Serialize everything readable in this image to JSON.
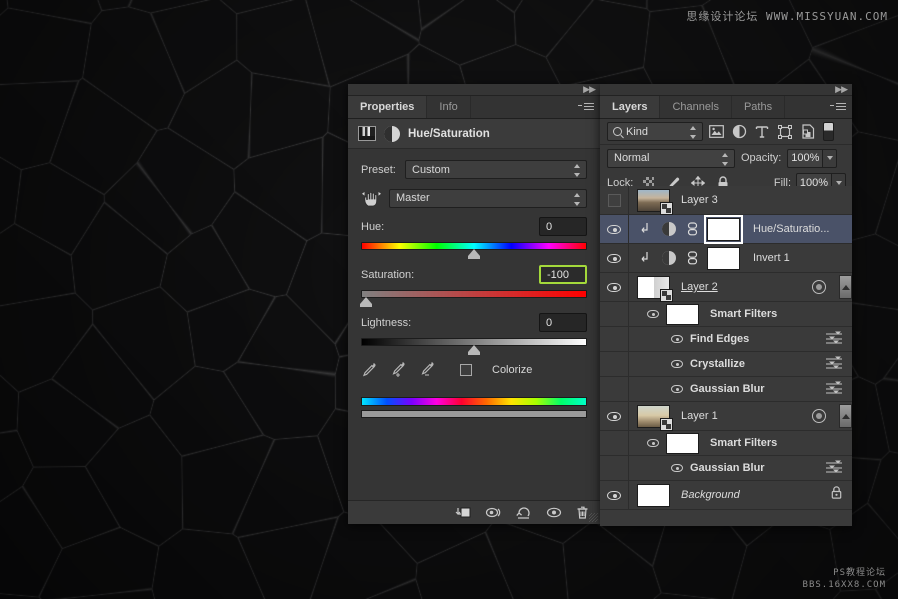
{
  "watermarks": {
    "top": "思缘设计论坛  WWW.MISSYUAN.COM",
    "bottom_line1": "PS教程论坛",
    "bottom_line2": "BBS.16XX8.COM"
  },
  "properties_panel": {
    "tabs": [
      {
        "label": "Properties",
        "active": true
      },
      {
        "label": "Info",
        "active": false
      }
    ],
    "title": "Hue/Saturation",
    "preset_label": "Preset:",
    "preset_value": "Custom",
    "channel_value": "Master",
    "sliders": [
      {
        "label": "Hue:",
        "value": "0",
        "thumb_pct": 50,
        "highlight": false
      },
      {
        "label": "Saturation:",
        "value": "-100",
        "thumb_pct": 2,
        "highlight": true
      },
      {
        "label": "Lightness:",
        "value": "0",
        "thumb_pct": 50,
        "highlight": false
      }
    ],
    "colorize_label": "Colorize",
    "colorize_checked": false,
    "footer_icons": [
      "clip-to-layer-icon",
      "toggle-previous-state-icon",
      "reset-icon",
      "toggle-visibility-icon",
      "delete-icon"
    ]
  },
  "layers_panel": {
    "tabs": [
      {
        "label": "Layers",
        "active": true
      },
      {
        "label": "Channels",
        "active": false
      },
      {
        "label": "Paths",
        "active": false
      }
    ],
    "filter_kind": "Kind",
    "filter_icons": [
      "pixel-filter-icon",
      "adjustment-filter-icon",
      "type-filter-icon",
      "shape-filter-icon",
      "smart-object-filter-icon"
    ],
    "blend_mode": "Normal",
    "opacity_label": "Opacity:",
    "opacity_value": "100%",
    "lock_label": "Lock:",
    "lock_icons": [
      "lock-transparent-pixels-icon",
      "lock-image-pixels-icon",
      "lock-position-icon",
      "lock-all-icon"
    ],
    "fill_label": "Fill:",
    "fill_value": "100%",
    "rows": [
      {
        "type": "layer",
        "name": "Layer 3",
        "visible": false,
        "selected": false,
        "thumb": "photo1",
        "smart_object": true,
        "style": "normal"
      },
      {
        "type": "adjustment",
        "name": "Hue/Saturatio...",
        "visible": true,
        "selected": true,
        "clipped": true,
        "linked": true,
        "mask_selected": true,
        "style": "normal"
      },
      {
        "type": "adjustment",
        "name": "Invert 1",
        "visible": true,
        "selected": false,
        "clipped": true,
        "linked": true,
        "mask_selected": false,
        "style": "normal"
      },
      {
        "type": "layer",
        "name": "Layer 2",
        "visible": true,
        "selected": false,
        "thumb": "half",
        "smart_object": true,
        "has_fx": true,
        "has_scroll": true,
        "style": "underline"
      },
      {
        "type": "smart-filters",
        "name": "Smart Filters",
        "visible": true
      },
      {
        "type": "filter",
        "name": "Find Edges",
        "visible": true
      },
      {
        "type": "filter",
        "name": "Crystallize",
        "visible": true
      },
      {
        "type": "filter",
        "name": "Gaussian Blur",
        "visible": true
      },
      {
        "type": "layer",
        "name": "Layer 1",
        "visible": true,
        "selected": false,
        "thumb": "photo2",
        "smart_object": true,
        "has_fx": true,
        "has_scroll": true,
        "style": "normal"
      },
      {
        "type": "smart-filters",
        "name": "Smart Filters",
        "visible": true
      },
      {
        "type": "filter",
        "name": "Gaussian Blur",
        "visible": true
      },
      {
        "type": "layer",
        "name": "Background",
        "visible": true,
        "selected": false,
        "thumb": "white",
        "locked": true,
        "style": "italic"
      }
    ]
  },
  "colors": {
    "panel_bg": "#353535",
    "layers_bg": "#3a3a3a",
    "selected_row": "#4a5268",
    "highlight_border": "#a4d93b",
    "text": "#dcdcdc"
  }
}
